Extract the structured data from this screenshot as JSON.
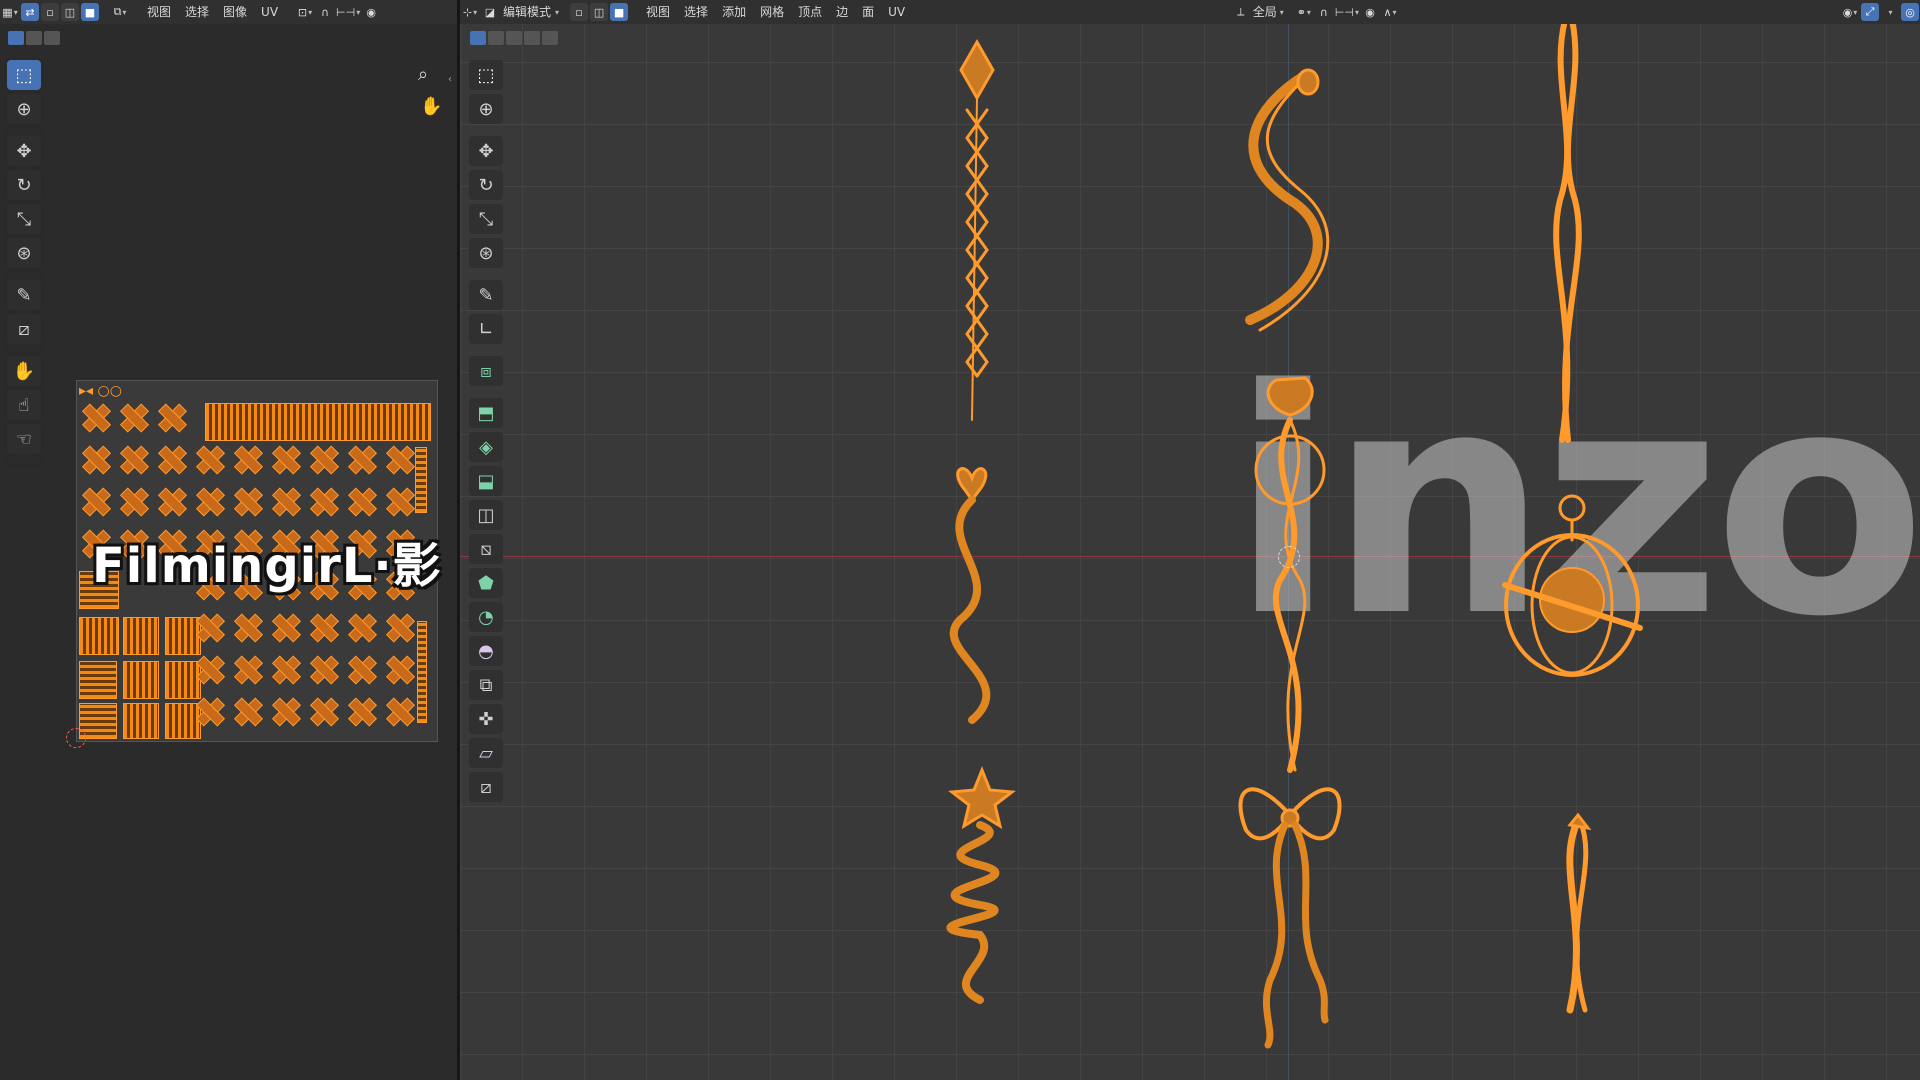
{
  "uv_header": {
    "menus": [
      "视图",
      "选择",
      "图像",
      "UV"
    ]
  },
  "viewport_header": {
    "mode": "编辑模式",
    "menus": [
      "视图",
      "选择",
      "添加",
      "网格",
      "顶点",
      "边",
      "面",
      "UV"
    ],
    "transform_orientation": "全局"
  },
  "watermark_text": "FilmingirL·影",
  "logo_text": "inzoi",
  "accent_color": "#4772b3",
  "mesh_color": "#ff9a2c",
  "uv_tools": [
    "select-box-icon",
    "cursor-icon",
    "move-icon",
    "rotate-icon",
    "scale-icon",
    "transform-icon",
    "annotate-icon",
    "rip-icon",
    "grab-icon",
    "relax-icon",
    "pinch-icon"
  ],
  "viewport_tools": [
    "select-box-icon",
    "cursor-icon",
    "move-icon",
    "rotate-icon",
    "scale-icon",
    "transform-icon",
    "annotate-icon",
    "measure-icon",
    "add-cube-icon",
    "extrude-icon",
    "inset-icon",
    "bevel-icon",
    "loop-cut-icon",
    "knife-icon",
    "poly-build-icon",
    "spin-icon",
    "smooth-icon",
    "edge-slide-icon",
    "shrink-icon",
    "shear-icon",
    "rip-region-icon"
  ]
}
